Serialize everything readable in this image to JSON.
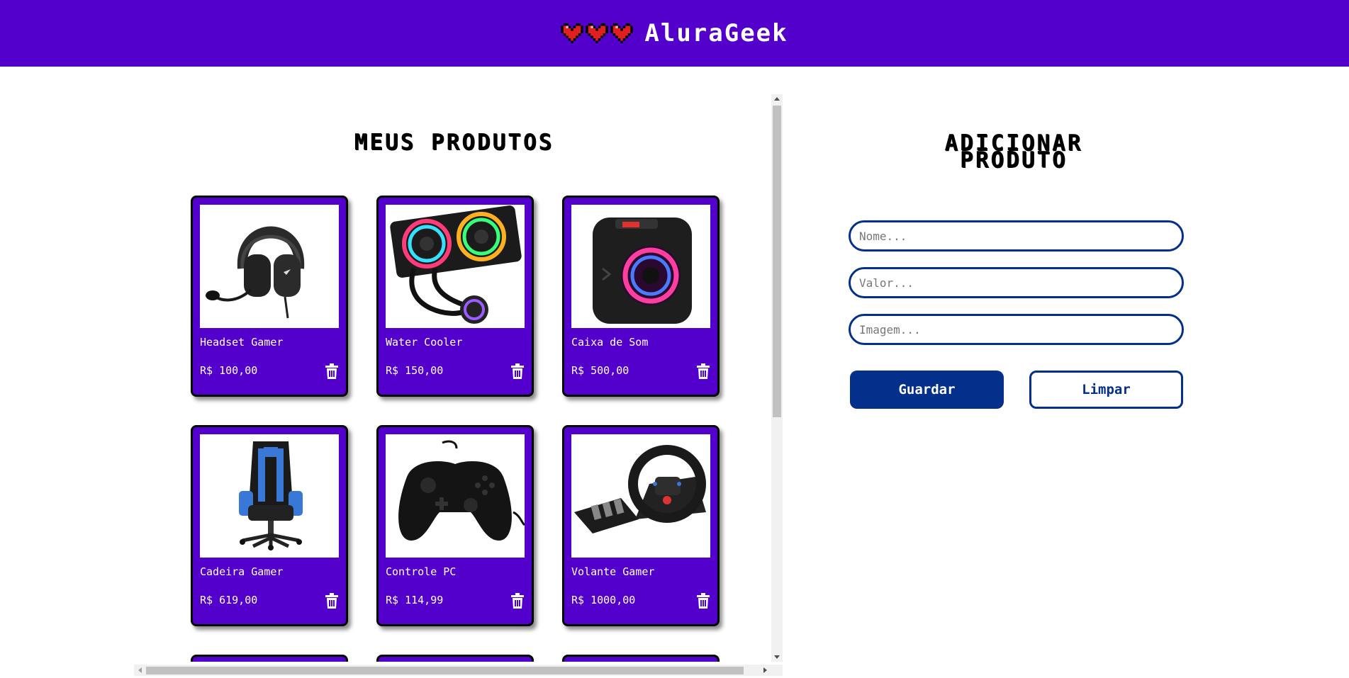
{
  "header": {
    "brand": "AluraGeek",
    "heart_icons": [
      "heart-icon",
      "heart-icon",
      "heart-icon"
    ]
  },
  "products": {
    "title": "MEUS PRODUTOS",
    "items": [
      {
        "name": "Headset Gamer",
        "price": "R$ 100,00",
        "image": "headset-image"
      },
      {
        "name": "Water Cooler",
        "price": "R$ 150,00",
        "image": "water-cooler-image"
      },
      {
        "name": "Caixa de Som",
        "price": "R$ 500,00",
        "image": "speaker-image"
      },
      {
        "name": "Cadeira Gamer",
        "price": "R$ 619,00",
        "image": "gaming-chair-image"
      },
      {
        "name": "Controle PC",
        "price": "R$ 114,99",
        "image": "controller-image"
      },
      {
        "name": "Volante Gamer",
        "price": "R$ 1000,00",
        "image": "steering-wheel-image"
      }
    ]
  },
  "form": {
    "title_line1": "ADICIONAR",
    "title_line2": "PRODUTO",
    "name_placeholder": "Nome...",
    "value_placeholder": "Valor...",
    "image_placeholder": "Imagem...",
    "save_label": "Guardar",
    "clear_label": "Limpar"
  },
  "colors": {
    "header_bg": "#5400cc",
    "card_bg": "#5400cc",
    "primary": "#04308c",
    "text_on_dark": "#ffffff"
  }
}
